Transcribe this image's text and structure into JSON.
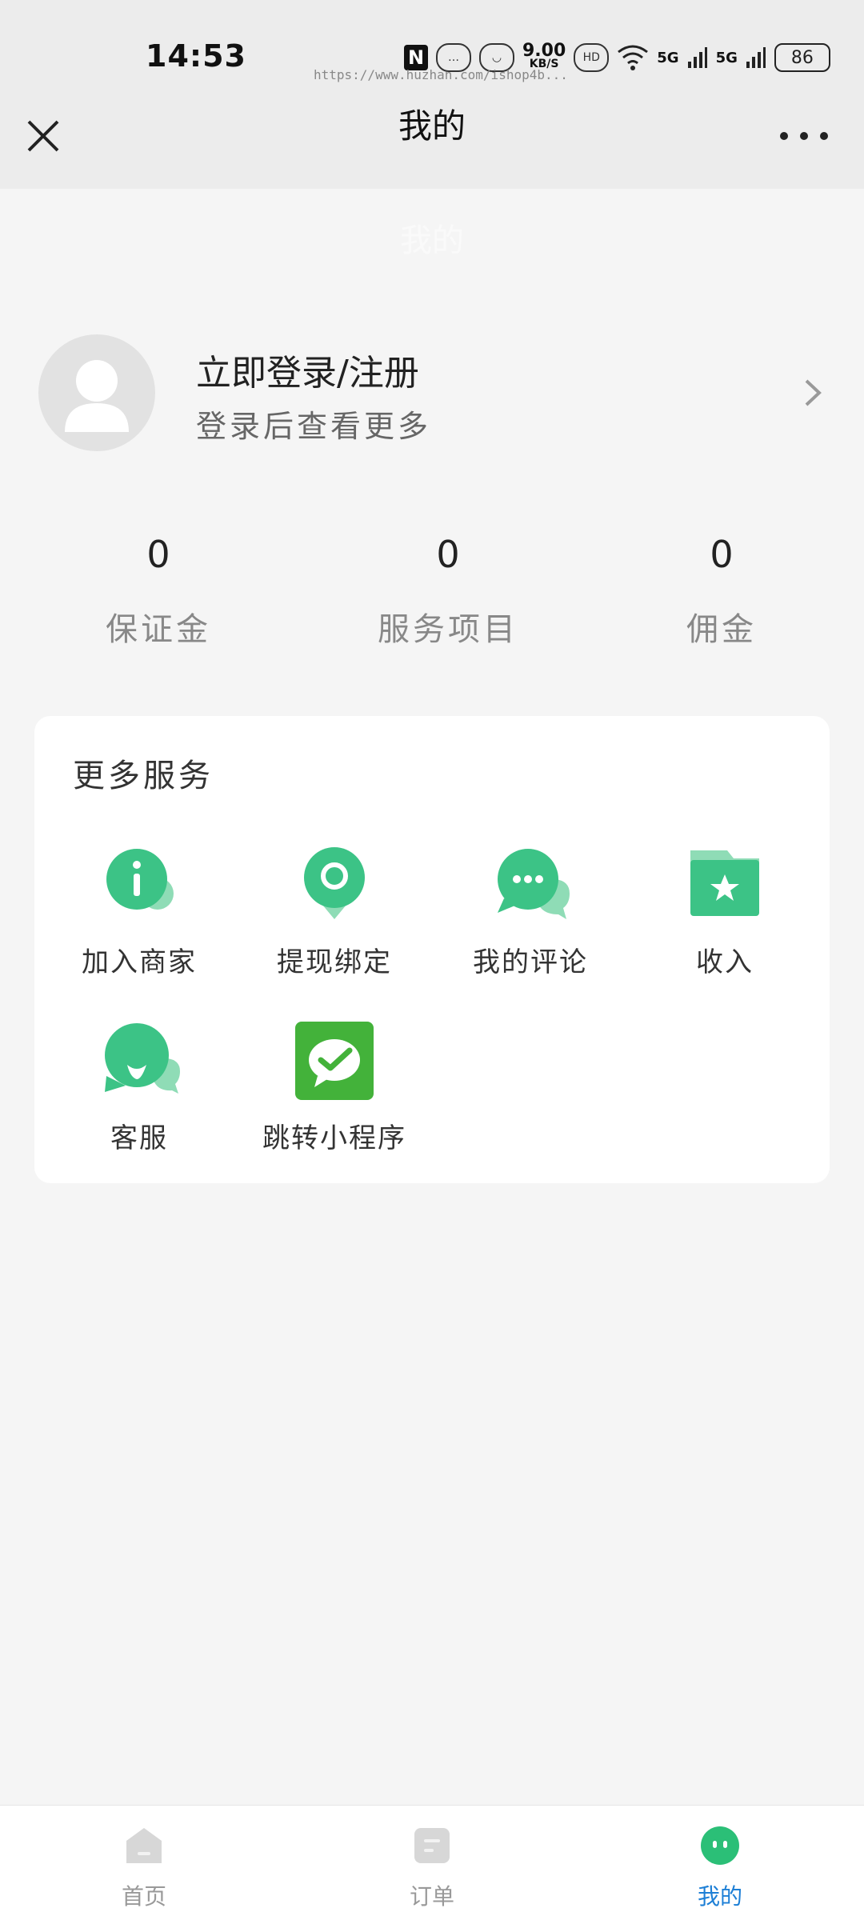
{
  "status_bar": {
    "time": "14:53",
    "nfc_label": "N",
    "net_speed_value": "9.00",
    "net_speed_unit": "KB/S",
    "hd_label": "HD",
    "sim1_label": "5G",
    "sim2_label": "5G",
    "battery": "86"
  },
  "watermark": "https://www.huzhan.com/ishop4b...",
  "nav": {
    "title": "我的"
  },
  "header": {
    "title": "我的"
  },
  "profile": {
    "title": "立即登录/注册",
    "subtitle": "登录后查看更多"
  },
  "stats": [
    {
      "value": "0",
      "label": "保证金"
    },
    {
      "value": "0",
      "label": "服务项目"
    },
    {
      "value": "0",
      "label": "佣金"
    }
  ],
  "services": {
    "title": "更多服务",
    "items": [
      {
        "label": "加入商家",
        "icon": "info-icon"
      },
      {
        "label": "提现绑定",
        "icon": "location-pin-icon"
      },
      {
        "label": "我的评论",
        "icon": "chat-bubble-icon"
      },
      {
        "label": "收入",
        "icon": "star-folder-icon"
      },
      {
        "label": "客服",
        "icon": "customer-service-icon"
      },
      {
        "label": "跳转小程序",
        "icon": "mini-program-icon"
      }
    ]
  },
  "tabbar": {
    "tabs": [
      {
        "label": "首页",
        "icon": "home-icon",
        "active": false
      },
      {
        "label": "订单",
        "icon": "order-icon",
        "active": false
      },
      {
        "label": "我的",
        "icon": "profile-icon",
        "active": true
      }
    ]
  },
  "colors": {
    "accent_green": "#3cc386",
    "wechat_green": "#43b23a",
    "active_tab_text": "#1d7fd6"
  }
}
